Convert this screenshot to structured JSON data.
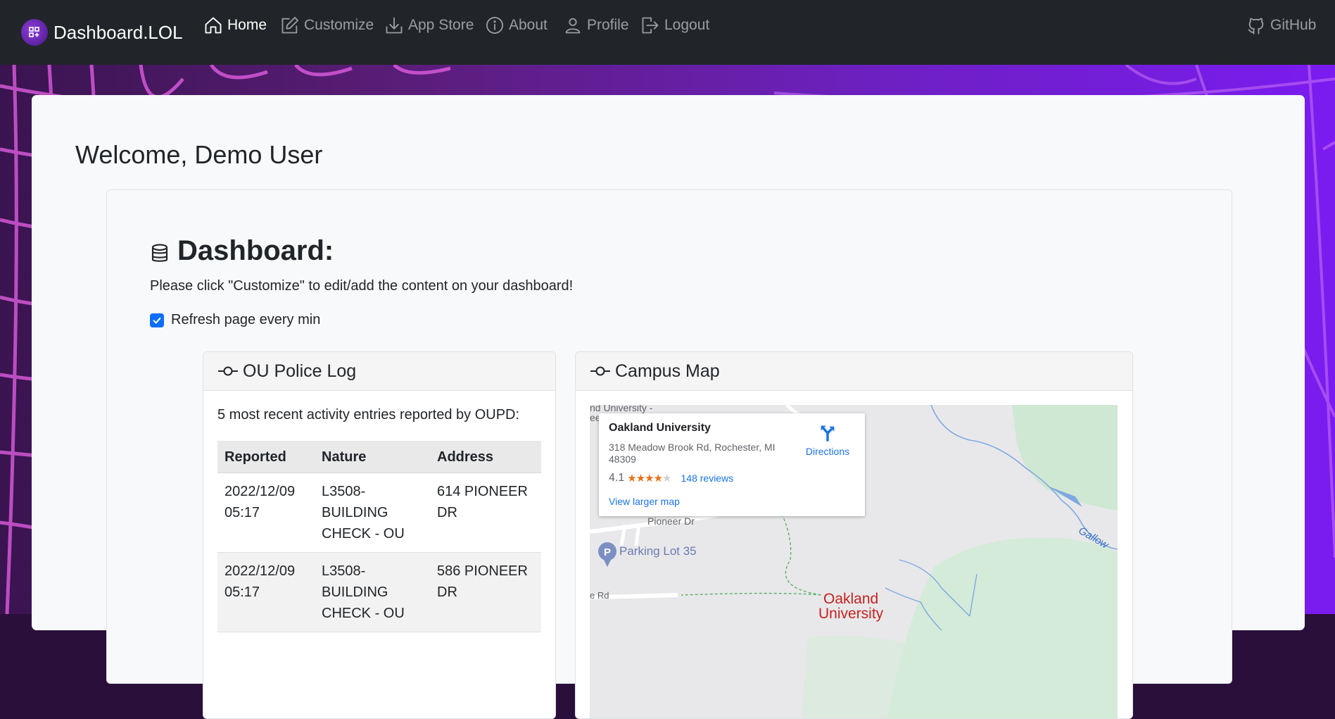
{
  "navbar": {
    "brand": "Dashboard.LOL",
    "items": [
      {
        "label": "Home",
        "icon": "home-icon",
        "active": true
      },
      {
        "label": "Customize",
        "icon": "pencil-square-icon"
      },
      {
        "label": "App Store",
        "icon": "download-icon"
      },
      {
        "label": "About",
        "icon": "info-circle-icon"
      },
      {
        "label": "Profile",
        "icon": "person-icon"
      },
      {
        "label": "Logout",
        "icon": "box-arrow-right-icon"
      }
    ],
    "github": "GitHub"
  },
  "main": {
    "welcome": "Welcome, Demo User",
    "dashboard_title": "Dashboard:",
    "dashboard_desc": "Please click \"Customize\" to edit/add the content on your dashboard!",
    "refresh_label": "Refresh page every min",
    "refresh_checked": true
  },
  "police_log": {
    "title": "OU Police Log",
    "lead": "5 most recent activity entries reported by OUPD:",
    "columns": [
      "Reported",
      "Nature",
      "Address"
    ],
    "rows": [
      {
        "reported": "2022/12/09 05:17",
        "nature": "L3508-BUILDING CHECK - OU",
        "address": "614 PIONEER DR"
      },
      {
        "reported": "2022/12/09 05:17",
        "nature": "L3508-BUILDING CHECK - OU",
        "address": "586 PIONEER DR"
      }
    ]
  },
  "campus_map": {
    "title": "Campus Map",
    "place_name": "Oakland University",
    "address": "318 Meadow Brook Rd, Rochester, MI 48309",
    "rating": "4.1",
    "stars": "★★★★",
    "star_empty": "★",
    "reviews": "148 reviews",
    "directions": "Directions",
    "view_larger": "View larger map",
    "labels": {
      "top_left": "nd University -",
      "top_left2": "ee",
      "pioneer": "Pioneer Dr",
      "parking": "Parking Lot 35",
      "road": "e Rd",
      "oakland1": "Oakland",
      "oakland2": "University",
      "gallow": "Gallow"
    }
  },
  "colors": {
    "navbar_bg": "#212529",
    "checkbox": "#0d6efd",
    "link_blue": "#1a73e8",
    "star_orange": "#e7711b",
    "map_red": "#c5221f"
  }
}
